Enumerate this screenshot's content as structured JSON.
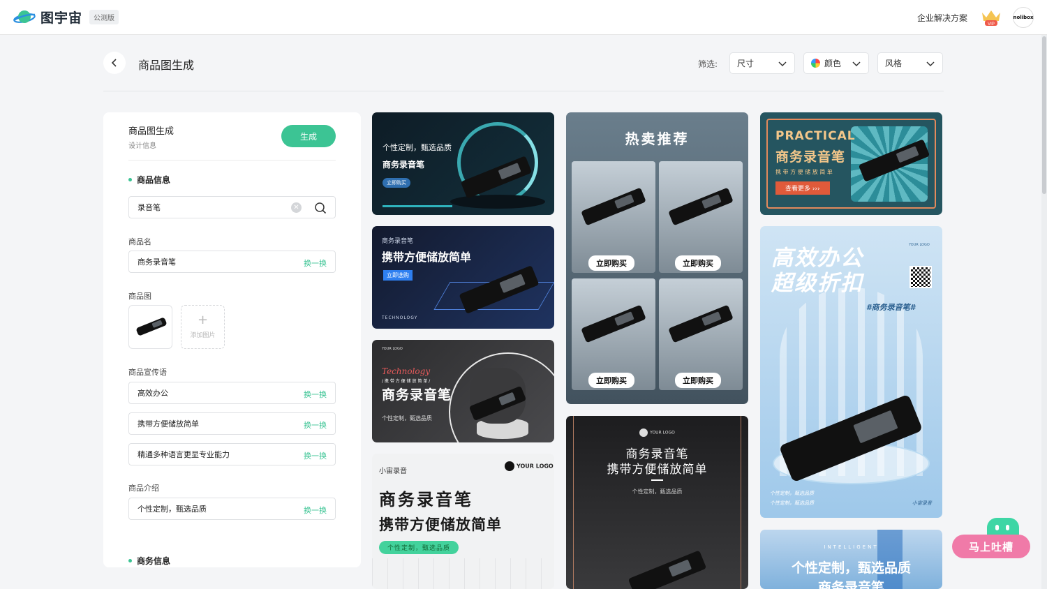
{
  "app": {
    "name": "图宇宙",
    "badge": "公测版",
    "enterprise_link": "企业解决方案",
    "vip_label": "VIP",
    "avatar_label": "nolibox"
  },
  "page": {
    "title": "商品图生成",
    "filter_label": "筛选:",
    "filters": [
      {
        "label": "尺寸"
      },
      {
        "label": "颜色"
      },
      {
        "label": "风格"
      }
    ]
  },
  "panel": {
    "title": "商品图生成",
    "subtitle": "设计信息",
    "generate_button": "生成",
    "section_product": "商品信息",
    "search_value": "录音笔",
    "name_label": "商品名",
    "name_value": "商务录音笔",
    "swap_label": "换一换",
    "image_label": "商品图",
    "add_image": "添加图片",
    "slogan_label": "商品宣传语",
    "slogans": [
      "高效办公",
      "携带方便储放简单",
      "精通多种语言更显专业能力"
    ],
    "intro_label": "商品介绍",
    "intro_value": "个性定制，甄选品质",
    "section_business": "商务信息"
  },
  "cards": {
    "c1": {
      "line1": "个性定制，甄选品质",
      "line2": "商务录音笔",
      "btn": "立即购买"
    },
    "c2": {
      "small": "商务录音笔",
      "big": "携带方便储放简单",
      "btn": "立即选购",
      "footer": "TECHNOLOGY"
    },
    "c3": {
      "logo": "YOUR LOGO",
      "script": "Technology",
      "tag": "/ 携 带 方 便 储 放 简 单 /",
      "big": "商务录音笔",
      "sub": "个性定制，甄选品质"
    },
    "c4": {
      "small": "小宙录音",
      "logo": "YOUR LOGO",
      "big1": "商务录音笔",
      "big2": "携带方便储放简单",
      "pill": "个性定制，甄选品质"
    },
    "c5": {
      "title": "热卖推荐",
      "btn": "立即购买"
    },
    "c6": {
      "logo": "YOUR LOGO",
      "line1": "商务录音笔",
      "line2": "携带方便储放简单",
      "sub": "个性定制，甄选品质"
    },
    "c7": {
      "en": "PRACTICAL",
      "big": "商务录音笔",
      "sub": "携 带 方 便 储 放 简 单",
      "btn": "查看更多 ›››"
    },
    "c8": {
      "big1": "高效办公",
      "big2": "超级折扣",
      "tag": "#商务录音笔#",
      "logo": "YOUR LOGO",
      "bottom1": "个性定制，甄选品质",
      "bottom2": "个性定制，甄选品质",
      "brand": "小宙录音"
    },
    "c9": {
      "en": "INTELLIGENT",
      "big": "个性定制，甄选品质",
      "big2": "商务录音笔"
    }
  },
  "feedback": {
    "label": "马上吐槽"
  },
  "colors": {
    "accent": "#3cc494",
    "feedback_pink": "#f07aa8",
    "feedback_green": "#3ed6a5"
  }
}
